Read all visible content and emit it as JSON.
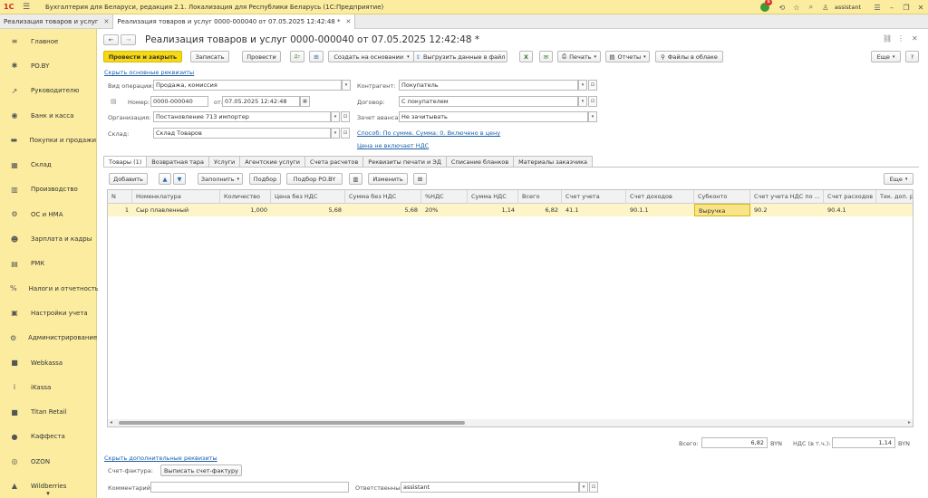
{
  "titlebar": {
    "logo": "1С",
    "title": "Бухгалтерия для Беларуси, редакция 2.1. Локализация для Республики Беларусь  (1С:Предприятие)",
    "user": "assistant",
    "notif_count": "5"
  },
  "open_tabs": [
    {
      "label": "Реализация товаров и услуг"
    },
    {
      "label": "Реализация товаров и услуг 0000-000040 от 07.05.2025 12:42:48 *"
    }
  ],
  "sidebar": {
    "items": [
      {
        "label": "Главное",
        "icon": "≡"
      },
      {
        "label": "PO.BY",
        "icon": "✱"
      },
      {
        "label": "Руководителю",
        "icon": "↗"
      },
      {
        "label": "Банк и касса",
        "icon": "◉"
      },
      {
        "label": "Покупки и продажи",
        "icon": "▬"
      },
      {
        "label": "Склад",
        "icon": "▦"
      },
      {
        "label": "Производство",
        "icon": "▥"
      },
      {
        "label": "ОС и НМА",
        "icon": "⚙"
      },
      {
        "label": "Зарплата и кадры",
        "icon": "☻"
      },
      {
        "label": "РМК",
        "icon": "▤"
      },
      {
        "label": "Налоги и отчетность",
        "icon": "%"
      },
      {
        "label": "Настройки учета",
        "icon": "▣"
      },
      {
        "label": "Администрирование",
        "icon": "⚙"
      },
      {
        "label": "Webkassa",
        "icon": "■"
      },
      {
        "label": "iKassa",
        "icon": "i"
      },
      {
        "label": "Titan Retail",
        "icon": "■"
      },
      {
        "label": "Каффеста",
        "icon": "●"
      },
      {
        "label": "OZON",
        "icon": "◎"
      },
      {
        "label": "Wildberries",
        "icon": "▲"
      }
    ],
    "more": "▾"
  },
  "doc": {
    "title": "Реализация товаров и услуг 0000-000040 от 07.05.2025 12:42:48 *",
    "toolbar": {
      "post_close": "Провести и закрыть",
      "save": "Записать",
      "post": "Провести",
      "create_based": "Создать на основании",
      "export": "Выгрузить данные в файл",
      "print": "Печать",
      "reports": "Отчеты",
      "files": "Файлы в облаке",
      "more": "Еще"
    },
    "hide_main": "Скрыть основные реквизиты",
    "fields": {
      "op_type_label": "Вид операции:",
      "op_type": "Продажа, комиссия",
      "number_label": "Номер:",
      "number": "0000-000040",
      "date_label": "от:",
      "date": "07.05.2025 12:42:48",
      "org_label": "Организация:",
      "org": "Постановление 713 импортер",
      "warehouse_label": "Склад:",
      "warehouse": "Склад Товаров",
      "counterparty_label": "Контрагент:",
      "counterparty": "Покупатель",
      "contract_label": "Договор:",
      "contract": "С покупателем",
      "advance_label": "Зачет аванса:",
      "advance": "Не зачитывать",
      "method_link": "Способ: По сумме. Сумма: 0. Включено в цену",
      "vat_link": "Цена не включает НДС"
    },
    "tabs": [
      "Товары (1)",
      "Возвратная тара",
      "Услуги",
      "Агентские услуги",
      "Счета расчетов",
      "Реквизиты печати и ЭД",
      "Списание бланков",
      "Материалы заказчика"
    ],
    "table_toolbar": {
      "add": "Добавить",
      "fill": "Заполнить",
      "pick": "Подбор",
      "pick_po": "Подбор PO.BY",
      "change": "Изменить",
      "more": "Еще"
    },
    "columns": [
      "N",
      "Номенклатура",
      "Количество",
      "Цена без НДС",
      "Сумма без НДС",
      "%НДС",
      "Сумма НДС",
      "Всего",
      "Счет учета",
      "Счет доходов",
      "Субконто",
      "Счет учета НДС по ...",
      "Счет расходов",
      "Тек. доп. р"
    ],
    "rows": [
      {
        "n": "1",
        "item": "Сыр плавленный",
        "qty": "1,000",
        "price": "5,68",
        "sum": "5,68",
        "vat_rate": "20%",
        "vat_sum": "1,14",
        "total": "6,82",
        "acc": "41.1",
        "income_acc": "90.1.1",
        "subconto": "Выручка",
        "vat_acc": "90.2",
        "expense_acc": "90.4.1"
      }
    ],
    "totals": {
      "total_label": "Всего:",
      "total": "6,82",
      "currency": "BYN",
      "vat_label": "НДС (в т.ч.):",
      "vat": "1,14"
    },
    "hide_extra": "Скрыть дополнительные реквизиты",
    "invoice_label": "Счет-фактура:",
    "invoice_btn": "Выписать счет-фактуру",
    "comment_label": "Комментарий:",
    "responsible_label": "Ответственный:",
    "responsible": "assistant"
  }
}
